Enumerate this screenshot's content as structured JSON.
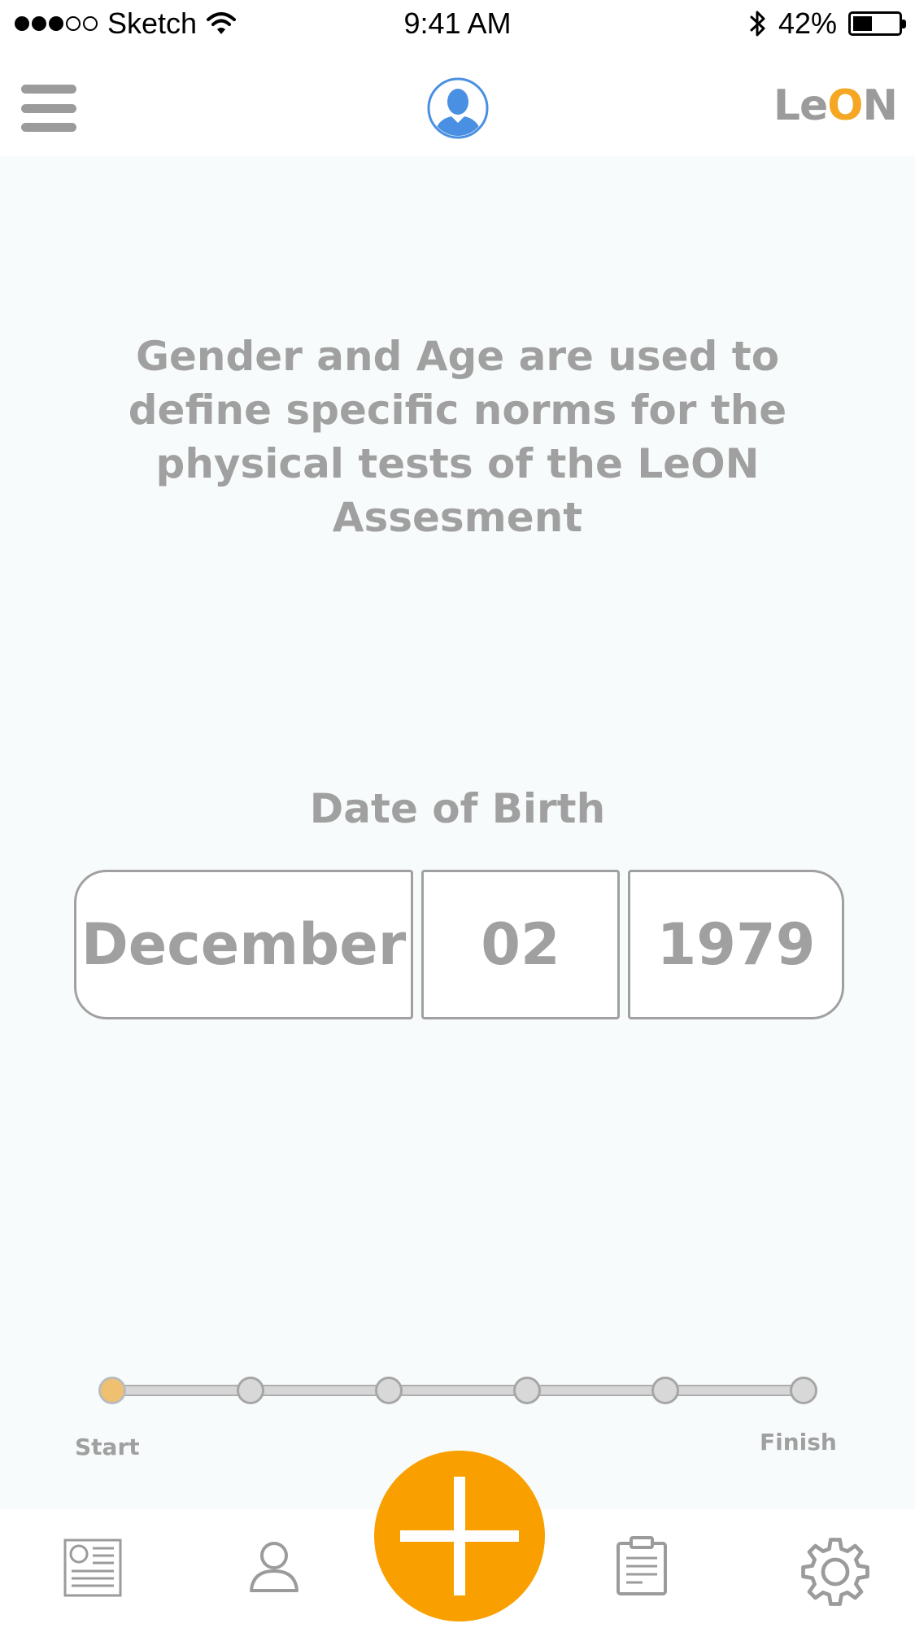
{
  "status_bar": {
    "carrier": "Sketch",
    "time": "9:41 AM",
    "battery_percent": "42%",
    "battery_level": 0.42,
    "signal_bars_filled": 3,
    "signal_bars_total": 5,
    "icons": [
      "wifi-icon",
      "bluetooth-icon",
      "battery-icon"
    ]
  },
  "header": {
    "logo": {
      "part1": "Le",
      "part2": "O",
      "part3": "N"
    },
    "icons": [
      "menu-icon",
      "avatar-icon"
    ]
  },
  "main": {
    "description": "Gender and Age are used to define specific norms for the physical tests of the LeON Assesment",
    "dob_label": "Date of Birth",
    "dob": {
      "month": "December",
      "day": "02",
      "year": "1979"
    }
  },
  "progress": {
    "start_label": "Start",
    "finish_label": "Finish",
    "total_steps": 6,
    "current_step": 1
  },
  "tab_bar": {
    "icons": [
      "news-icon",
      "profile-icon",
      "add-icon",
      "clipboard-icon",
      "settings-icon"
    ]
  },
  "colors": {
    "accent": "#F9A000",
    "logo_accent": "#F5A623",
    "text_gray": "#A0A0A0",
    "avatar_blue": "#4A90E2",
    "background": "#F8FBFC"
  }
}
